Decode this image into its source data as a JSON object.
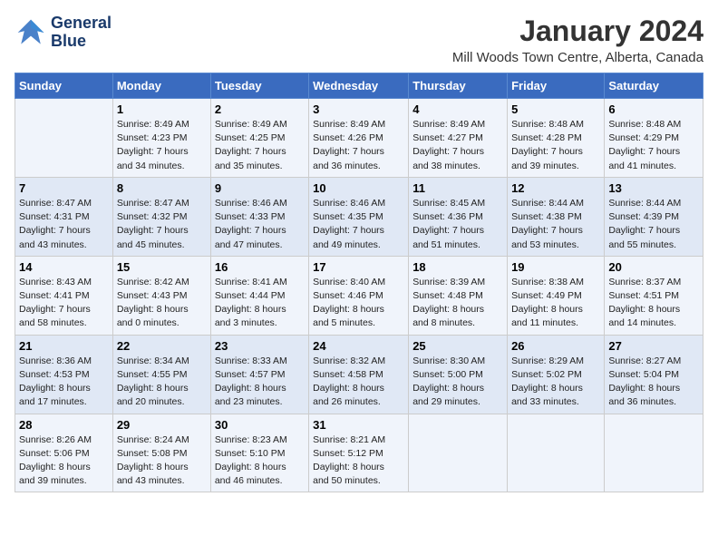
{
  "header": {
    "logo_line1": "General",
    "logo_line2": "Blue",
    "month": "January 2024",
    "location": "Mill Woods Town Centre, Alberta, Canada"
  },
  "weekdays": [
    "Sunday",
    "Monday",
    "Tuesday",
    "Wednesday",
    "Thursday",
    "Friday",
    "Saturday"
  ],
  "weeks": [
    [
      {
        "day": "",
        "info": ""
      },
      {
        "day": "1",
        "info": "Sunrise: 8:49 AM\nSunset: 4:23 PM\nDaylight: 7 hours\nand 34 minutes."
      },
      {
        "day": "2",
        "info": "Sunrise: 8:49 AM\nSunset: 4:25 PM\nDaylight: 7 hours\nand 35 minutes."
      },
      {
        "day": "3",
        "info": "Sunrise: 8:49 AM\nSunset: 4:26 PM\nDaylight: 7 hours\nand 36 minutes."
      },
      {
        "day": "4",
        "info": "Sunrise: 8:49 AM\nSunset: 4:27 PM\nDaylight: 7 hours\nand 38 minutes."
      },
      {
        "day": "5",
        "info": "Sunrise: 8:48 AM\nSunset: 4:28 PM\nDaylight: 7 hours\nand 39 minutes."
      },
      {
        "day": "6",
        "info": "Sunrise: 8:48 AM\nSunset: 4:29 PM\nDaylight: 7 hours\nand 41 minutes."
      }
    ],
    [
      {
        "day": "7",
        "info": "Sunrise: 8:47 AM\nSunset: 4:31 PM\nDaylight: 7 hours\nand 43 minutes."
      },
      {
        "day": "8",
        "info": "Sunrise: 8:47 AM\nSunset: 4:32 PM\nDaylight: 7 hours\nand 45 minutes."
      },
      {
        "day": "9",
        "info": "Sunrise: 8:46 AM\nSunset: 4:33 PM\nDaylight: 7 hours\nand 47 minutes."
      },
      {
        "day": "10",
        "info": "Sunrise: 8:46 AM\nSunset: 4:35 PM\nDaylight: 7 hours\nand 49 minutes."
      },
      {
        "day": "11",
        "info": "Sunrise: 8:45 AM\nSunset: 4:36 PM\nDaylight: 7 hours\nand 51 minutes."
      },
      {
        "day": "12",
        "info": "Sunrise: 8:44 AM\nSunset: 4:38 PM\nDaylight: 7 hours\nand 53 minutes."
      },
      {
        "day": "13",
        "info": "Sunrise: 8:44 AM\nSunset: 4:39 PM\nDaylight: 7 hours\nand 55 minutes."
      }
    ],
    [
      {
        "day": "14",
        "info": "Sunrise: 8:43 AM\nSunset: 4:41 PM\nDaylight: 7 hours\nand 58 minutes."
      },
      {
        "day": "15",
        "info": "Sunrise: 8:42 AM\nSunset: 4:43 PM\nDaylight: 8 hours\nand 0 minutes."
      },
      {
        "day": "16",
        "info": "Sunrise: 8:41 AM\nSunset: 4:44 PM\nDaylight: 8 hours\nand 3 minutes."
      },
      {
        "day": "17",
        "info": "Sunrise: 8:40 AM\nSunset: 4:46 PM\nDaylight: 8 hours\nand 5 minutes."
      },
      {
        "day": "18",
        "info": "Sunrise: 8:39 AM\nSunset: 4:48 PM\nDaylight: 8 hours\nand 8 minutes."
      },
      {
        "day": "19",
        "info": "Sunrise: 8:38 AM\nSunset: 4:49 PM\nDaylight: 8 hours\nand 11 minutes."
      },
      {
        "day": "20",
        "info": "Sunrise: 8:37 AM\nSunset: 4:51 PM\nDaylight: 8 hours\nand 14 minutes."
      }
    ],
    [
      {
        "day": "21",
        "info": "Sunrise: 8:36 AM\nSunset: 4:53 PM\nDaylight: 8 hours\nand 17 minutes."
      },
      {
        "day": "22",
        "info": "Sunrise: 8:34 AM\nSunset: 4:55 PM\nDaylight: 8 hours\nand 20 minutes."
      },
      {
        "day": "23",
        "info": "Sunrise: 8:33 AM\nSunset: 4:57 PM\nDaylight: 8 hours\nand 23 minutes."
      },
      {
        "day": "24",
        "info": "Sunrise: 8:32 AM\nSunset: 4:58 PM\nDaylight: 8 hours\nand 26 minutes."
      },
      {
        "day": "25",
        "info": "Sunrise: 8:30 AM\nSunset: 5:00 PM\nDaylight: 8 hours\nand 29 minutes."
      },
      {
        "day": "26",
        "info": "Sunrise: 8:29 AM\nSunset: 5:02 PM\nDaylight: 8 hours\nand 33 minutes."
      },
      {
        "day": "27",
        "info": "Sunrise: 8:27 AM\nSunset: 5:04 PM\nDaylight: 8 hours\nand 36 minutes."
      }
    ],
    [
      {
        "day": "28",
        "info": "Sunrise: 8:26 AM\nSunset: 5:06 PM\nDaylight: 8 hours\nand 39 minutes."
      },
      {
        "day": "29",
        "info": "Sunrise: 8:24 AM\nSunset: 5:08 PM\nDaylight: 8 hours\nand 43 minutes."
      },
      {
        "day": "30",
        "info": "Sunrise: 8:23 AM\nSunset: 5:10 PM\nDaylight: 8 hours\nand 46 minutes."
      },
      {
        "day": "31",
        "info": "Sunrise: 8:21 AM\nSunset: 5:12 PM\nDaylight: 8 hours\nand 50 minutes."
      },
      {
        "day": "",
        "info": ""
      },
      {
        "day": "",
        "info": ""
      },
      {
        "day": "",
        "info": ""
      }
    ]
  ]
}
